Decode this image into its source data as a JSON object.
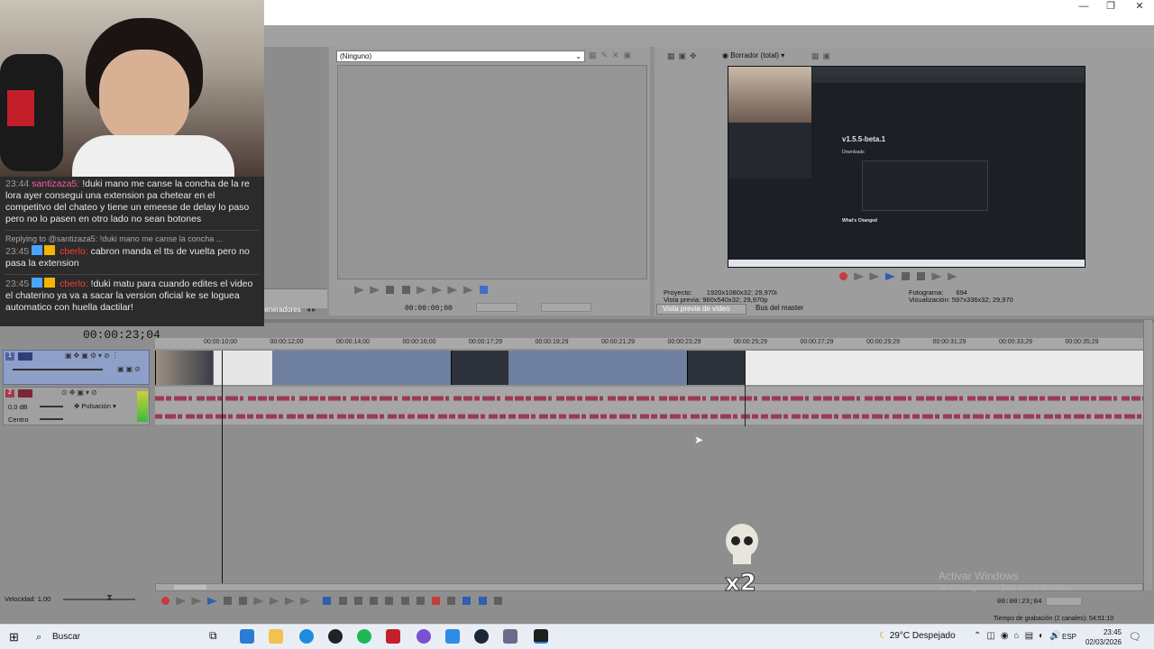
{
  "window": {
    "minimize": "—",
    "restore": "❐",
    "close": "✕"
  },
  "chat": {
    "messages": [
      {
        "time": "23:44",
        "user": "santizaza5",
        "text": "!duki mano me canse la concha de la re lora ayer consegui una extension pa chetear en el competitvo del chateo y tiene un emeese de delay lo paso pero no lo pasen en otro lado no sean botones"
      },
      {
        "reply": "Replying to @santizaza5: !duki mano me canse la concha ...",
        "time": "23:45",
        "user": "cberlo",
        "text": "cabron manda el tts de vuelta pero no pasa la extension"
      },
      {
        "time": "23:45",
        "user": "cberlo",
        "text": "!duki matu para cuando edites el video el chaterino ya va a sacar la version oficial ke se loguea automatico con huella dactilar!"
      }
    ]
  },
  "trimmer": {
    "dropdown": "(Ninguno)",
    "time": "00:00:00;00"
  },
  "preview": {
    "mode": "Borrador (total)",
    "project_label": "Proyecto:",
    "project_value": "1920x1080x32; 29,970i",
    "vista_label": "Vista previa:",
    "vista_value": "960x540x32; 29,970p",
    "frame_label": "Fotograma:",
    "frame_value": "694",
    "visual_label": "Visualización:",
    "visual_value": "597x336x32; 29,970",
    "tab_video": "Vista previa de vídeo",
    "tab_master": "Bus del master",
    "overlay_title": "v1.5.5-beta.1",
    "overlay_sub": "Downloads",
    "overlay_changed": "What's Changed"
  },
  "left_tabs": {
    "label": "Generadores de me"
  },
  "timeline": {
    "timecode": "00:00:23;04",
    "ruler": [
      "00:00:10;00",
      "00:00:12;00",
      "00:00:14;00",
      "00:00:16;00",
      "00:00:17;29",
      "00:00:19;29",
      "00:00:21;29",
      "00:00:23;29",
      "00:00:25;29",
      "00:00:27;29",
      "00:00:29;29",
      "00:00:31;29",
      "00:00:33;29",
      "00:00:35;29"
    ],
    "video_track_num": "1",
    "audio_track_num": "2",
    "audio_db": "0,0 dB",
    "audio_mode": "Pulsación",
    "audio_pan": "Centro",
    "speed": "Velocidad: 1,00",
    "end_time": "00:00:23;04",
    "record_time": "Tiempo de grabación (2 canales): 54:51:10"
  },
  "watermark": {
    "line1": "Activar Windows",
    "line2": "Ve a Configuración para activar Windows."
  },
  "overlay_badge": "x2",
  "taskbar": {
    "search": "Buscar",
    "weather": "29°C  Despejado",
    "lang": "ESP",
    "time": "23:45",
    "date": "02/03/2026"
  },
  "colors": {
    "video_track": "#6f7fa0",
    "clip_waveform": "#9b3b55",
    "chat_bg": "#2b2b2b"
  }
}
